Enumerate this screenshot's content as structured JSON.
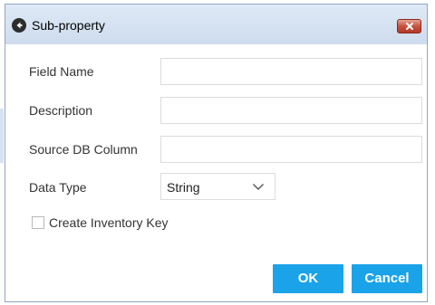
{
  "dialog": {
    "title": "Sub-property",
    "title_icon": "back-arrow-icon",
    "close_icon": "close-icon"
  },
  "form": {
    "field_name_label": "Field Name",
    "field_name_value": "",
    "description_label": "Description",
    "description_value": "",
    "source_db_column_label": "Source DB Column",
    "source_db_column_value": "",
    "data_type_label": "Data Type",
    "data_type_value": "String",
    "create_inventory_key_label": "Create Inventory Key",
    "create_inventory_key_checked": false
  },
  "buttons": {
    "ok_label": "OK",
    "cancel_label": "Cancel"
  },
  "colors": {
    "accent": "#1aa3e8",
    "close_button": "#c5523f",
    "titlebar": "#d6e2f1"
  }
}
